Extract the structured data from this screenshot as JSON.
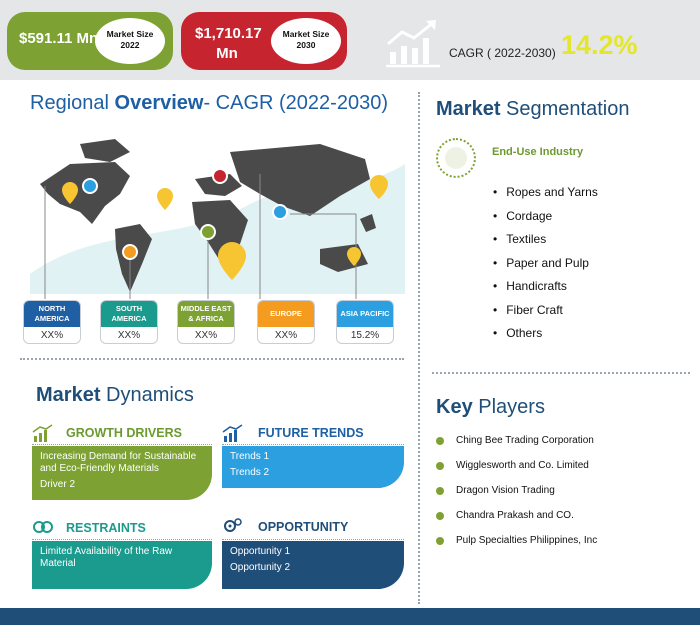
{
  "header": {
    "market_2022": {
      "value": "$591.11 Mn",
      "label_line1": "Market Size",
      "label_line2": "2022"
    },
    "market_2030": {
      "value_line1": "$1,710.17",
      "value_line2": "Mn",
      "label_line1": "Market Size",
      "label_line2": "2030"
    },
    "cagr_label": "CAGR ( 2022-2030)",
    "cagr_value": "14.2%"
  },
  "regional": {
    "title_prefix": "Regional ",
    "title_bold": "Overview",
    "title_suffix": "- CAGR (2022-2030)",
    "regions": [
      {
        "name_line1": "NORTH",
        "name_line2": "AMERICA",
        "value": "XX%",
        "color": "#1f5fa3"
      },
      {
        "name_line1": "SOUTH",
        "name_line2": "AMERICA",
        "value": "XX%",
        "color": "#1a9b8e"
      },
      {
        "name_line1": "MIDDLE EAST",
        "name_line2": "& AFRICA",
        "value": "XX%",
        "color": "#7da233"
      },
      {
        "name_line1": "EUROPE",
        "name_line2": "",
        "value": "XX%",
        "color": "#f39c1f"
      },
      {
        "name_line1": "ASIA PACIFIC",
        "name_line2": "",
        "value": "15.2%",
        "color": "#2b9fe0"
      }
    ]
  },
  "segmentation": {
    "title_bold": "Market",
    "title_rest": " Segmentation",
    "category": "End-Use Industry",
    "items": [
      "Ropes and Yarns",
      "Cordage",
      "Textiles",
      "Paper and Pulp",
      "Handicrafts",
      "Fiber Craft",
      "Others"
    ]
  },
  "dynamics": {
    "title_bold": "Market",
    "title_rest": " Dynamics",
    "growth_drivers": {
      "title": "GROWTH DRIVERS",
      "items": [
        "Increasing Demand for Sustainable and Eco-Friendly Materials",
        "Driver 2"
      ],
      "color": "#7da233"
    },
    "future_trends": {
      "title": "FUTURE TRENDS",
      "items": [
        "Trends 1",
        "Trends 2"
      ],
      "color": "#2b9fe0"
    },
    "restraints": {
      "title": "RESTRAINTS",
      "items": [
        "Limited Availability of the Raw Material"
      ],
      "color": "#1a9b8e"
    },
    "opportunity": {
      "title": "OPPORTUNITY",
      "items": [
        "Opportunity 1",
        "Opportunity 2"
      ],
      "color": "#1f4e79"
    }
  },
  "key_players": {
    "title_bold": "Key",
    "title_rest": " Players",
    "items": [
      "Ching Bee Trading Corporation",
      "Wigglesworth and Co. Limited",
      "Dragon Vision Trading",
      "Chandra Prakash and CO.",
      "Pulp Specialties Philippines, Inc"
    ]
  },
  "colors": {
    "primary_green": "#7da233",
    "primary_red": "#c6242f",
    "navy": "#1f4e79",
    "blue": "#1f5fa3",
    "cagr_yellow": "#e3e62a"
  }
}
